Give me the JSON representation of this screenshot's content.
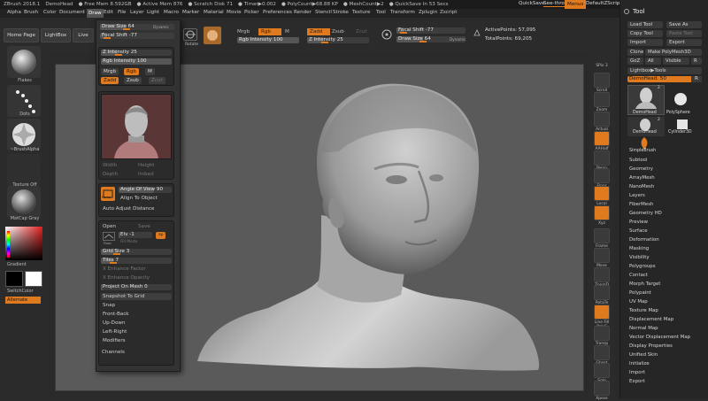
{
  "titlebar": {
    "items": [
      "ZBrush 2018.1",
      "DemoHead",
      "● Free Mem 8.592GB",
      "● Active Mem 876",
      "● Scratch Disk 71",
      "● Timer▶0.002",
      "● PolyCount▶68.88 KP",
      "● MeshCount▶2",
      "● QuickSave In 53 Secs"
    ],
    "quicksave": "QuickSave",
    "seethrough": "See-through  0",
    "menus": "Menus",
    "script": "DefaultZScript"
  },
  "menubar": {
    "items": [
      "Alpha",
      "Brush",
      "Color",
      "Document",
      "Draw",
      "Edit",
      "File",
      "Layer",
      "Light",
      "Macro",
      "Marker",
      "Material",
      "Movie",
      "Picker",
      "Preferences",
      "Render",
      "Stencil",
      "Stroke",
      "Texture",
      "Tool",
      "Transform",
      "Zplugin",
      "Zscript"
    ],
    "active": "Draw"
  },
  "toprow": {
    "home": "Home Page",
    "lightbox": "LightBox",
    "live": "Live",
    "rotate": "Rotate",
    "mrgb": "Mrgb",
    "rgb": "Rgb",
    "m": "M",
    "zadd": "Zadd",
    "zsub": "Zsub",
    "zcut": "Zcut",
    "rgb_intensity": "Rgb Intensity 100",
    "z_intensity": "Z Intensity 25",
    "focal_shift": "Focal Shift -77",
    "draw_size": "Draw Size 64",
    "dynamic": "Dynamic",
    "active_points": "ActivePoints: 57,095",
    "total_points": "TotalPoints: 69,205"
  },
  "leftshelf": {
    "flakes": "Flakes",
    "dots": "Dots",
    "brushalpha": "~BrushAlpha",
    "texture": "Texture Off",
    "matcap": "MatCap Gray",
    "gradient": "Gradient",
    "switchcolor": "SwitchColor",
    "alternate": "Alternate",
    "colors": {
      "accent": "#e07a1f",
      "main": "#000000",
      "secondary": "#ffffff"
    }
  },
  "drawmenu": {
    "draw_size": "Draw Size 64",
    "dynamic": "Dynamic",
    "focal_shift": "Focal Shift -77",
    "z_intensity": "Z Intensity 25",
    "rgb_intensity": "Rgb Intensity 100",
    "mrgb": "Mrgb",
    "rgb": "Rgb",
    "m": "M",
    "zadd": "Zadd",
    "zsub": "Zsub",
    "zcut": "Zcut",
    "width": "Width",
    "height": "Height",
    "depth": "Depth",
    "imbed": "Imbed",
    "persp": "Persp",
    "angle_of_view": "Angle Of View 90",
    "align_to_object": "Align To Object",
    "auto_adjust": "Auto Adjust Distance",
    "open": "Open",
    "save": "Save",
    "floor": "Floor",
    "elv": "Elv -1",
    "fill_mode": "Fill Mode",
    "ap": "ap",
    "grid_size": "Grid Size 3",
    "tiles": "Tiles 7",
    "x_enhance": "X Enhance Factor",
    "snapshot_opacity": "X Enhance Opacity",
    "project_on_mesh": "Project On Mesh 0",
    "snapshot_to_grid": "Snapshot To Grid",
    "snap": "Snap",
    "front_back": "Front-Back",
    "up_down": "Up-Down",
    "left_right": "Left-Right",
    "modifiers": "Modifiers",
    "channels": "Channels"
  },
  "rightshelf": [
    "SPix 3",
    "Scroll",
    "Zoom",
    "Actual",
    "AAHalf",
    "Persp",
    "Floor",
    "Local",
    "Xyz",
    "Frame",
    "Move",
    "ZoomD",
    "RotaTe",
    "Line Fill PolyF",
    "Transp",
    "Ghost",
    "Solo",
    "Xpose"
  ],
  "toolpanel": {
    "header": "Tool",
    "load_tool": "Load Tool",
    "save_as": "Save As",
    "copy_tool": "Copy Tool",
    "paste_tool": "Paste Tool",
    "import": "Import",
    "export": "Export",
    "clone": "Clone",
    "make_polymesh": "Make PolyMesh3D",
    "goz": "GoZ",
    "all": "All",
    "visible": "Visible",
    "r": "R",
    "lightbox_tools": "Lightbox▶Tools",
    "demohead_slider": "DemoHead. 50",
    "thumbs": [
      "DemoHead",
      "PolySphere",
      "DemoHead",
      "Cylinder3D",
      "SimpleBrush"
    ],
    "thumb_counts": [
      "2",
      "2"
    ],
    "sections": [
      "Subtool",
      "Geometry",
      "ArrayMesh",
      "NanoMesh",
      "Layers",
      "FiberMesh",
      "Geometry HD",
      "Preview",
      "Surface",
      "Deformation",
      "Masking",
      "Visibility",
      "Polygroups",
      "Contact",
      "Morph Target",
      "Polypaint",
      "UV Map",
      "Texture Map",
      "Displacement Map",
      "Normal Map",
      "Vector Displacement Map",
      "Display Properties",
      "Unified Skin",
      "Initialize",
      "Import",
      "Export"
    ]
  }
}
